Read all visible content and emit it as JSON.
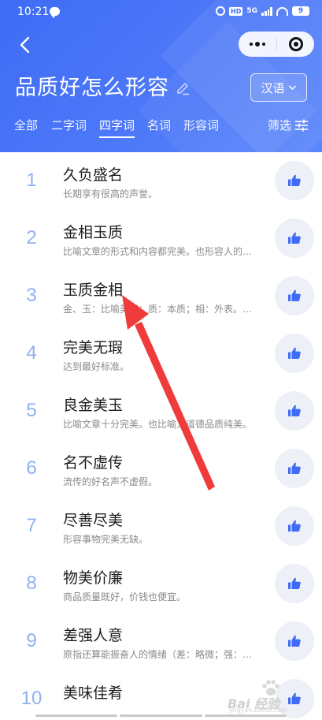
{
  "status_bar": {
    "time": "10:21",
    "hd_label": "HD",
    "network_label": "5G",
    "battery": "9"
  },
  "header": {
    "title": "品质好怎么形容",
    "lang_button": "汉语",
    "tabs": [
      {
        "label": "全部"
      },
      {
        "label": "二字词"
      },
      {
        "label": "四字词"
      },
      {
        "label": "名词"
      },
      {
        "label": "形容词"
      }
    ],
    "active_tab": "四字词",
    "filter_label": "筛选"
  },
  "results": [
    {
      "rank": "1",
      "word": "久负盛名",
      "definition": "长期享有很高的声誉。"
    },
    {
      "rank": "2",
      "word": "金相玉质",
      "definition": "比喻文章的形式和内容都完美。也形容人的相貌和品质都很好。"
    },
    {
      "rank": "3",
      "word": "玉质金相",
      "definition": "金、玉：比喻美好；质：本质；相：外表。比喻文章的形式和内容都完美。"
    },
    {
      "rank": "4",
      "word": "完美无瑕",
      "definition": "达到最好标准。"
    },
    {
      "rank": "5",
      "word": "良金美玉",
      "definition": "比喻文章十分完美。也比喻人道德品质纯美。"
    },
    {
      "rank": "6",
      "word": "名不虚传",
      "definition": "流传的好名声不虚假。"
    },
    {
      "rank": "7",
      "word": "尽善尽美",
      "definition": "形容事物完美无缺。"
    },
    {
      "rank": "8",
      "word": "物美价廉",
      "definition": "商品质量既好，价钱也便宜。"
    },
    {
      "rank": "9",
      "word": "差强人意",
      "definition": "原指还算能振奋人的情绪（差：略微；强：振奋）。"
    },
    {
      "rank": "10",
      "word": "美味佳肴",
      "definition": ""
    }
  ],
  "watermark": {
    "title": "Bai 经验",
    "subtitle": "jingyan.baidu.com"
  },
  "colors": {
    "header_blue": "#4a74f7",
    "rank_number": "#8fb0ee",
    "like_icon": "#3f6cf6",
    "annotation_arrow": "#ef3b3b"
  }
}
